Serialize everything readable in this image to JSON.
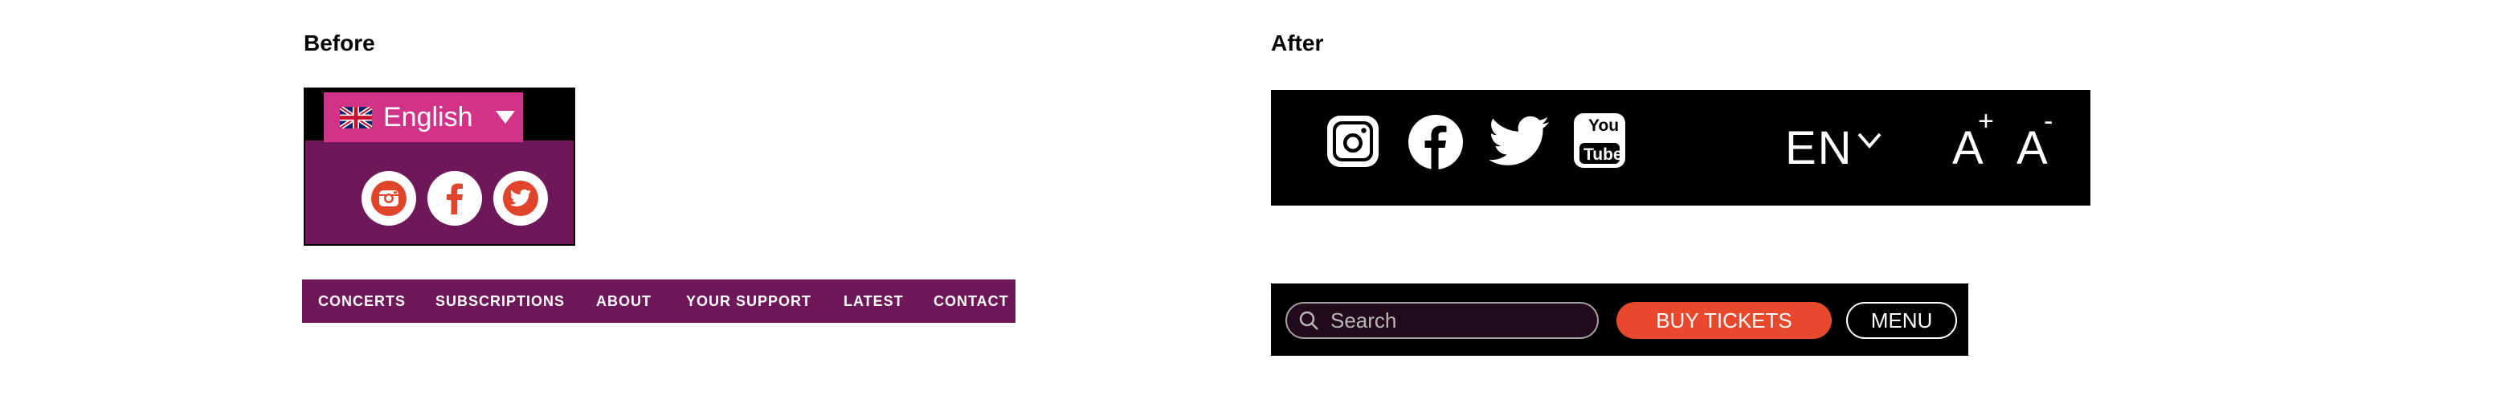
{
  "headings": {
    "before": "Before",
    "after": "After"
  },
  "before": {
    "language": {
      "label": "English",
      "flag_icon": "uk-flag-icon",
      "caret_icon": "caret-down-icon"
    },
    "social": [
      "instagram-icon",
      "facebook-icon",
      "twitter-icon"
    ],
    "nav": [
      "CONCERTS",
      "SUBSCRIPTIONS",
      "ABOUT",
      "YOUR SUPPORT",
      "LATEST",
      "CONTACT"
    ],
    "colors": {
      "purple": "#6e1859",
      "pink": "#d33289",
      "social_red": "#e0452c"
    }
  },
  "after": {
    "social": [
      "instagram-icon",
      "facebook-icon",
      "twitter-icon",
      "youtube-icon"
    ],
    "youtube_text": {
      "top": "You",
      "bottom": "Tube"
    },
    "language": "EN",
    "font_increase": {
      "letter": "A",
      "symbol": "+"
    },
    "font_decrease": {
      "letter": "A",
      "symbol": "-"
    },
    "search": {
      "placeholder": "Search"
    },
    "buy_tickets": "BUY TICKETS",
    "menu": "MENU",
    "colors": {
      "bar": "#000000",
      "buy": "#e8492c"
    }
  }
}
